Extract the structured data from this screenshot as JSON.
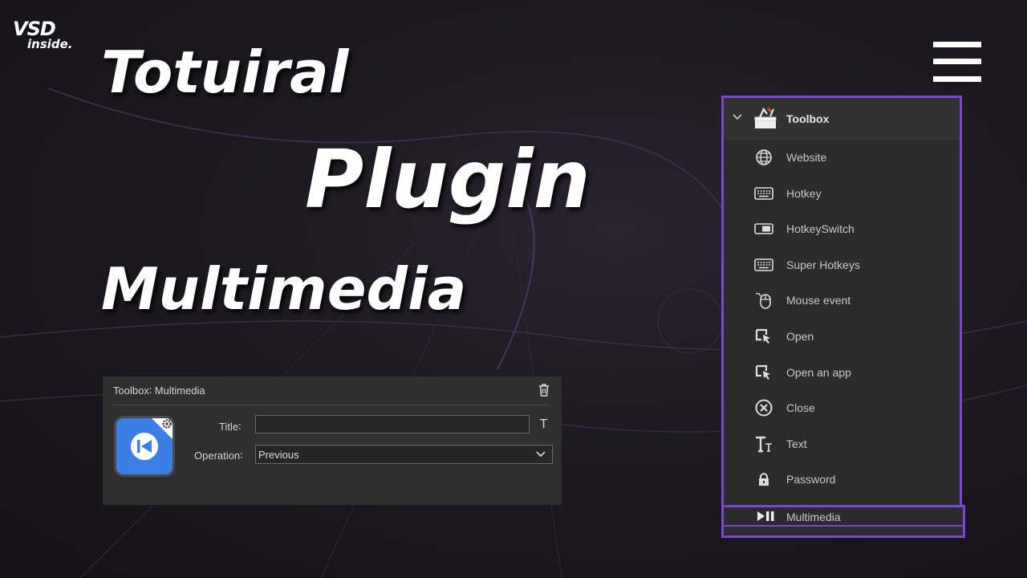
{
  "logo": {
    "brand": "VSD",
    "sub": "inside."
  },
  "headline": {
    "line1": "Totuiral",
    "line2": "Plugin",
    "line3": "Multimedia"
  },
  "panel": {
    "title": "Toolbox",
    "items": [
      {
        "label": "Website",
        "icon": "globe-icon"
      },
      {
        "label": "Hotkey",
        "icon": "keyboard-icon"
      },
      {
        "label": "HotkeySwitch",
        "icon": "toggle-switch-icon"
      },
      {
        "label": "Super Hotkeys",
        "icon": "keyboard-icon"
      },
      {
        "label": "Mouse event",
        "icon": "mouse-icon"
      },
      {
        "label": "Open",
        "icon": "open-cursor-icon"
      },
      {
        "label": "Open an app",
        "icon": "open-cursor-icon"
      },
      {
        "label": "Close",
        "icon": "close-circle-icon"
      },
      {
        "label": "Text",
        "icon": "text-icon"
      },
      {
        "label": "Password",
        "icon": "lock-icon"
      }
    ],
    "selected": {
      "label": "Multimedia",
      "icon": "play-pause-icon"
    }
  },
  "dialog": {
    "title": "Toolbox∶ Multimedia",
    "title_label": "Title∶",
    "title_value": "",
    "t_button": "T",
    "operation_label": "Operation∶",
    "operation_value": "Previous"
  },
  "colors": {
    "accent": "#7b45d6",
    "app_icon": "#3b7fe6",
    "panel_bg": "#2b2b2b"
  }
}
